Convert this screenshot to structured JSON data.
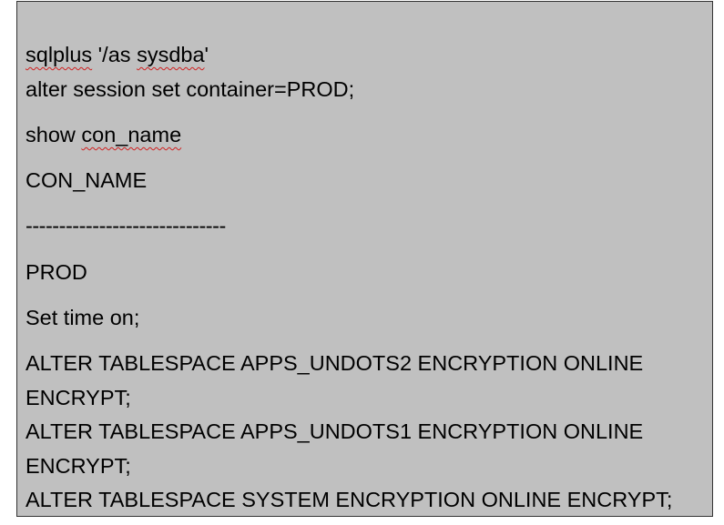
{
  "lines": {
    "l1_word1": "sqlplus",
    "l1_mid": " '/as ",
    "l1_word2": "sysdba",
    "l1_end": "'",
    "l2": "alter session set container=PROD;",
    "l3_start": "show ",
    "l3_word": "con_name",
    "l4": "CON_NAME",
    "l5": "------------------------------",
    "l6": "PROD",
    "l7": "Set time on;",
    "l8": "ALTER TABLESPACE APPS_UNDOTS2 ENCRYPTION ONLINE",
    "l9": "ENCRYPT;",
    "l10": "ALTER TABLESPACE APPS_UNDOTS1 ENCRYPTION ONLINE",
    "l11": "ENCRYPT;",
    "l12": "ALTER TABLESPACE SYSTEM ENCRYPTION ONLINE ENCRYPT;"
  },
  "colors": {
    "background": "#c0c0c0",
    "border": "#333333",
    "text": "#000000",
    "spellcheck_underline": "#d02020"
  }
}
